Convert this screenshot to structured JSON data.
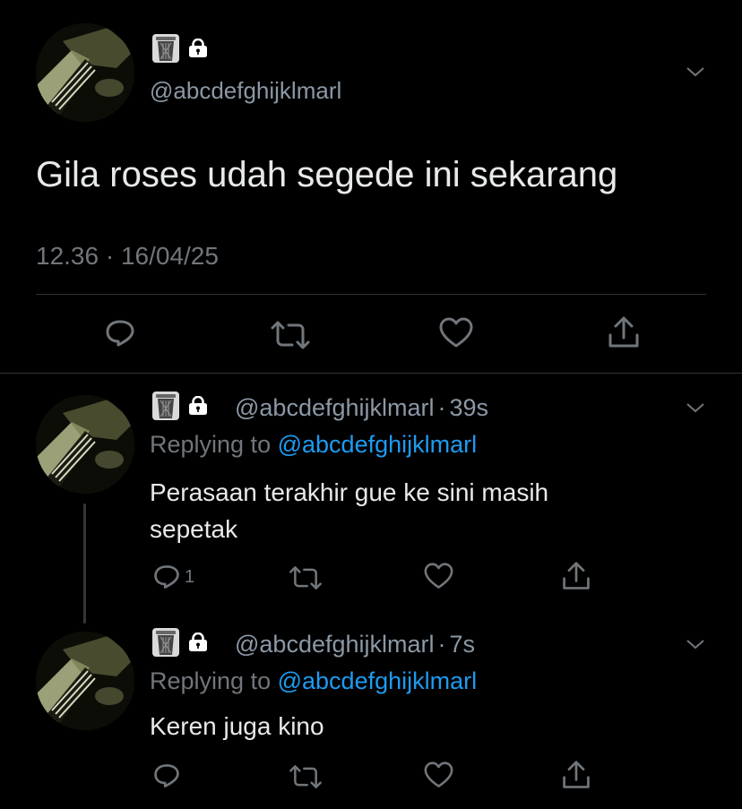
{
  "main_tweet": {
    "handle": "@abcdefghijklmarl",
    "text": "Gila roses udah segede ini sekarang",
    "timestamp": "12.36 · 16/04/25"
  },
  "replies": [
    {
      "handle": "@abcdefghijklmarl",
      "time": "39s",
      "replying_prefix": "Replying to",
      "replying_to": "@abcdefghijklmarl",
      "text_line1": "Perasaan terakhir gue ke sini masih",
      "text_line2": "sepetak",
      "reply_count": "1"
    },
    {
      "handle": "@abcdefghijklmarl",
      "time": "7s",
      "replying_prefix": "Replying to",
      "replying_to": "@abcdefghijklmarl",
      "text_line1": "Keren juga kino",
      "reply_count": ""
    }
  ],
  "separator": "·",
  "icons": [
    "trash-icon",
    "lock-icon",
    "chevron-down-icon",
    "reply-icon",
    "retweet-icon",
    "like-icon",
    "share-icon"
  ],
  "colors": {
    "background": "#000000",
    "link": "#1d9bf0",
    "muted": "#71767b",
    "divider": "#2f3336"
  }
}
